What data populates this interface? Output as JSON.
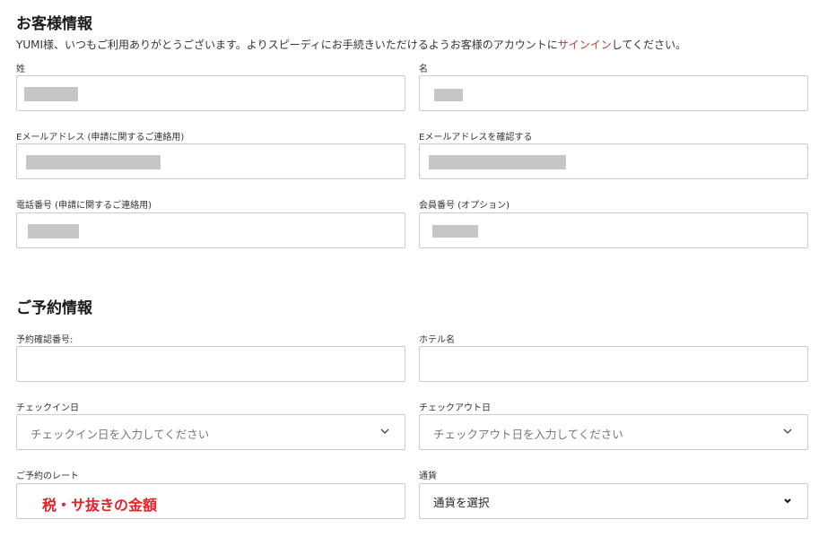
{
  "customer": {
    "title": "お客様情報",
    "intro_text": "YUMI様、いつもご利用ありがとうございます。よりスピーディにお手続きいただけるようお客様のアカウントに",
    "intro_link": "サインイン",
    "intro_suffix": "してください。",
    "last_name_label": "姓",
    "first_name_label": "名",
    "email_label": "Eメールアドレス (申請に関するご連絡用)",
    "email_confirm_label": "Eメールアドレスを確認する",
    "phone_label": "電話番号 (申請に関するご連絡用)",
    "member_label": "会員番号 (オプション)"
  },
  "reservation": {
    "title": "ご予約情報",
    "confirmation_label": "予約確認番号:",
    "hotel_label": "ホテル名",
    "checkin_label": "チェックイン日",
    "checkin_placeholder": "チェックイン日を入力してください",
    "checkout_label": "チェックアウト日",
    "checkout_placeholder": "チェックアウト日を入力してください",
    "rate_label": "ご予約のレート",
    "rate_annotation": "税・サ抜きの金額",
    "currency_label": "通貨",
    "currency_value": "通貨を選択"
  },
  "colors": {
    "link": "#c0392b",
    "annotation": "#e8202a",
    "redaction": "#c6c6c6",
    "border": "#cccccc"
  }
}
